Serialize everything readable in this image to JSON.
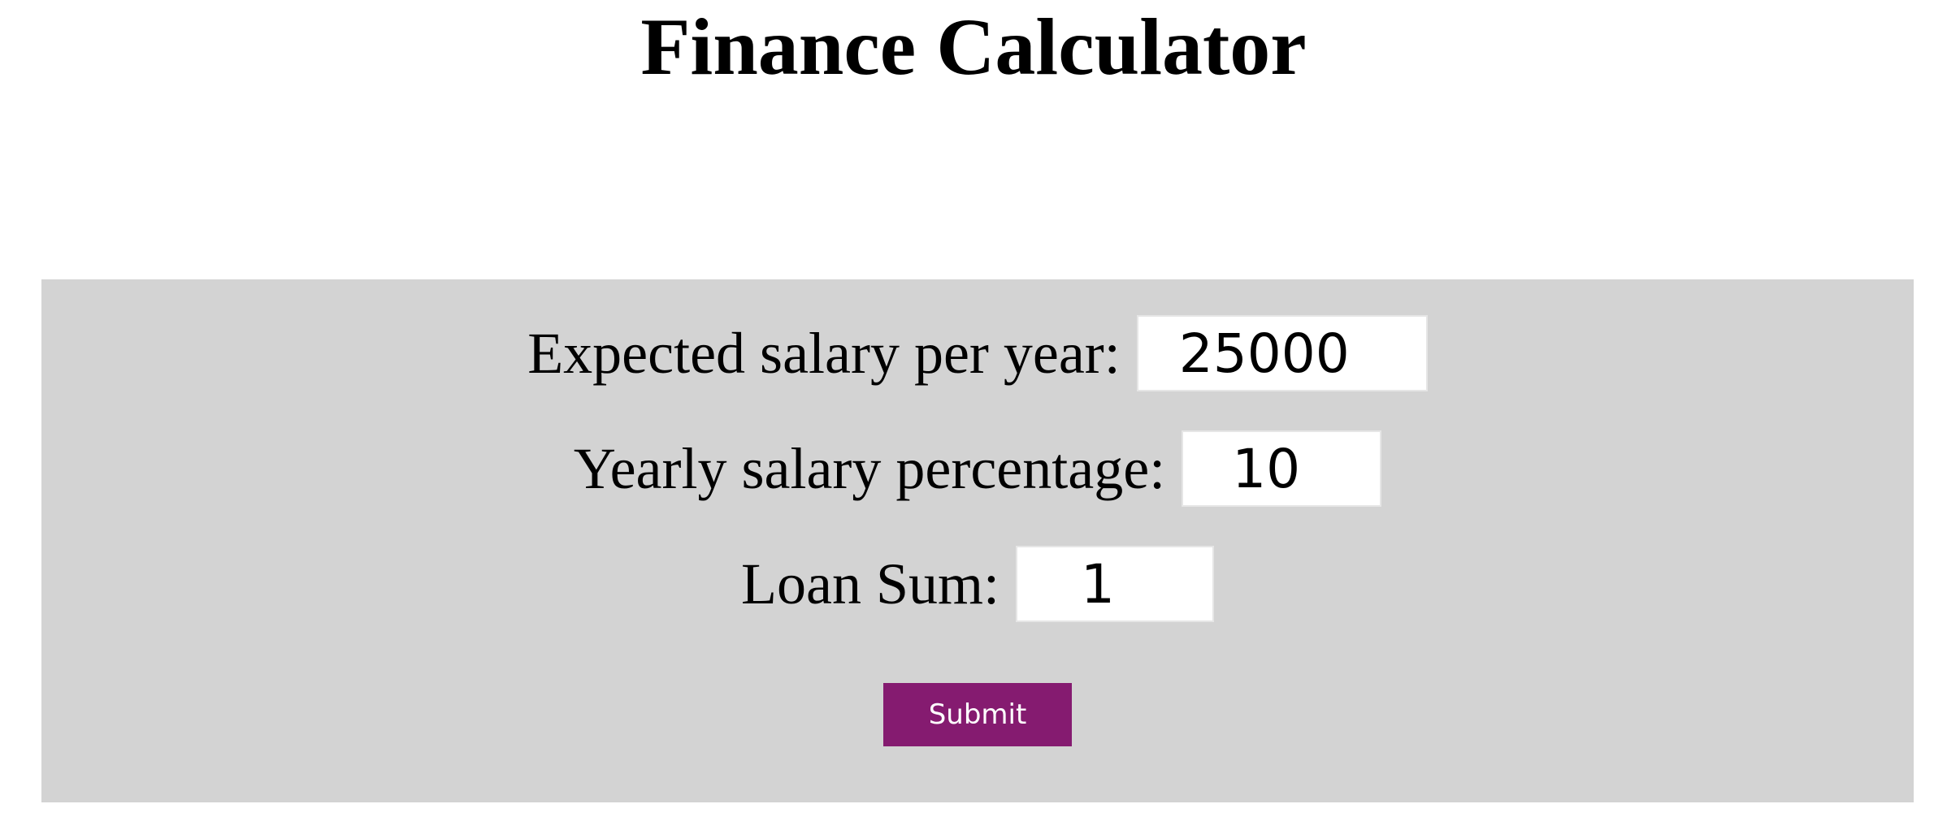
{
  "header": {
    "title": "Finance Calculator"
  },
  "form": {
    "fields": [
      {
        "label": "Expected salary per year:",
        "value": "25000"
      },
      {
        "label": "Yearly salary percentage:",
        "value": "10"
      },
      {
        "label": "Loan Sum:",
        "value": "1"
      }
    ],
    "submit_label": "Submit"
  },
  "colors": {
    "panel_background": "#d3d3d3",
    "submit_background": "#851b70",
    "submit_text": "#ffffff"
  }
}
